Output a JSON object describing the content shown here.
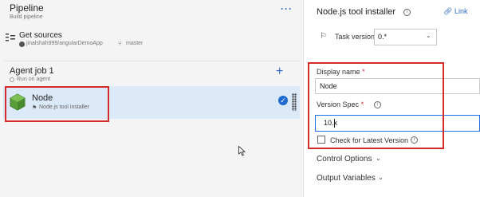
{
  "pipeline": {
    "title": "Pipeline",
    "subtitle": "Build pipeline",
    "more_label": "···"
  },
  "sources": {
    "title": "Get sources",
    "repo": "jinalshah999/angularDemoApp",
    "branch": "master"
  },
  "agent_job": {
    "title": "Agent job 1",
    "subtitle": "Run on agent",
    "add_label": "+"
  },
  "task": {
    "title": "Node",
    "subtitle": "Node.js tool installer",
    "status_icon": "check-circle-icon"
  },
  "details": {
    "title": "Node.js tool installer",
    "link_label": "Link",
    "task_version_label": "Task version",
    "task_version_value": "0.*",
    "display_name_label": "Display name",
    "display_name_value": "Node",
    "version_spec_label": "Version Spec",
    "version_spec_value": "10.x",
    "checkbox_label": "Check for Latest Version",
    "checkbox_checked": false,
    "required_marker": "*",
    "control_options_label": "Control Options",
    "output_variables_label": "Output Variables"
  },
  "colors": {
    "accent": "#2b6ac1",
    "highlight": "#d42a2a",
    "selected_row": "#dbe9f8"
  }
}
